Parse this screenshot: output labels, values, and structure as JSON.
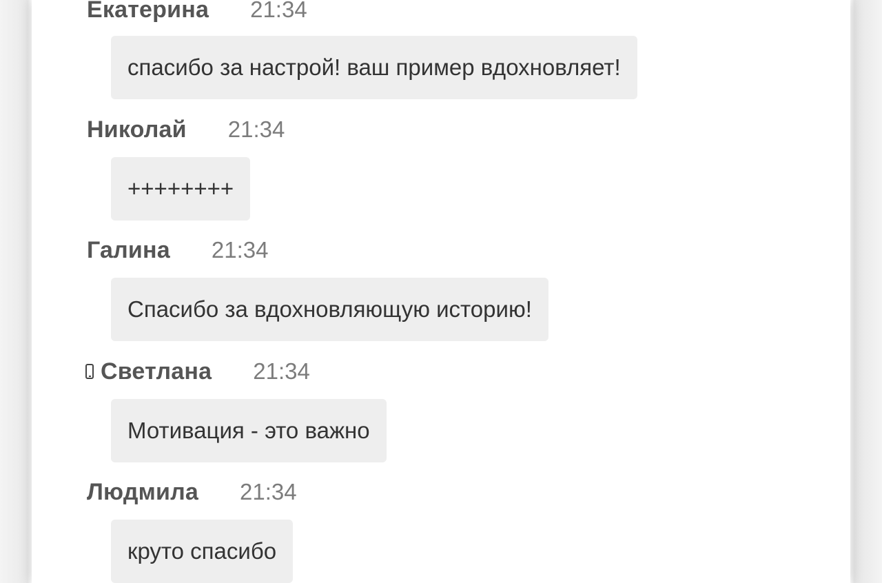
{
  "messages": [
    {
      "author": "Екатерина",
      "time": "21:34",
      "text": "спасибо за настрой! ваш пример вдохновляет!",
      "mobile": false
    },
    {
      "author": "Николай",
      "time": "21:34",
      "text": "++++++++",
      "mobile": false
    },
    {
      "author": "Галина",
      "time": "21:34",
      "text": "Спасибо за вдохновляющую историю!",
      "mobile": false
    },
    {
      "author": "Светлана",
      "time": "21:34",
      "text": "Мотивация - это важно",
      "mobile": true
    },
    {
      "author": "Людмила",
      "time": "21:34",
      "text": "круто спасибо",
      "mobile": false
    }
  ],
  "colors": {
    "bubble": "#eeeeee",
    "author": "#555555",
    "time": "#7c7c7c",
    "text": "#333333"
  },
  "icons": {
    "mobile": "mobile-phone-icon"
  }
}
